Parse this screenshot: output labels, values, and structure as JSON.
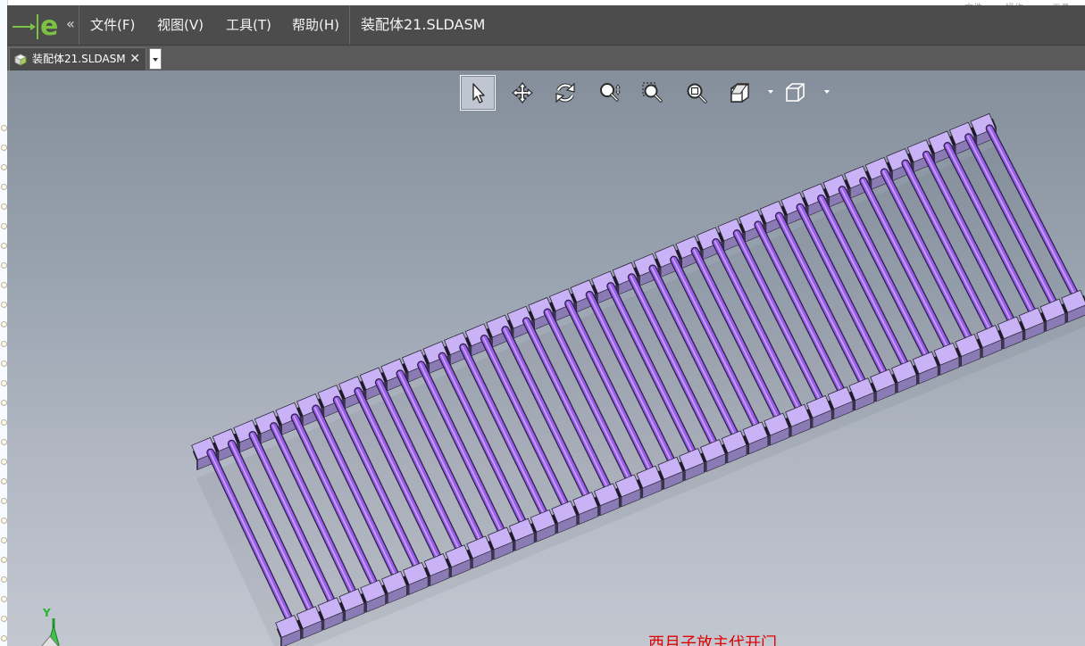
{
  "app": {
    "logo_icon": "edrawings-logo-icon",
    "brand_color": "#7cc242",
    "collapse_label": "«"
  },
  "menu": {
    "items": [
      {
        "label": "文件(F)"
      },
      {
        "label": "视图(V)"
      },
      {
        "label": "工具(T)"
      },
      {
        "label": "帮助(H)"
      }
    ],
    "document_title": "装配体21.SLDASM"
  },
  "tabs": [
    {
      "label": "装配体21.SLDASM",
      "close_label": "✕",
      "icon": "assembly-icon"
    }
  ],
  "toolbar": {
    "tools": [
      {
        "name": "select-tool",
        "icon": "pointer-icon",
        "active": true
      },
      {
        "name": "pan-tool",
        "icon": "move-icon",
        "active": false
      },
      {
        "name": "rotate-tool",
        "icon": "rotate-icon",
        "active": false
      },
      {
        "name": "zoom-tool",
        "icon": "zoom-icon",
        "active": false
      },
      {
        "name": "zoom-area-tool",
        "icon": "zoom-area-icon",
        "active": false
      },
      {
        "name": "zoom-fit-tool",
        "icon": "zoom-fit-icon",
        "active": false
      },
      {
        "name": "section-view-tool",
        "icon": "section-icon",
        "active": false
      },
      {
        "name": "display-style-tool",
        "icon": "cube-icon",
        "active": false
      }
    ]
  },
  "viewport": {
    "part_color": "#c9b2f5",
    "rod_color": "#9a5fe8",
    "rod_count": 38,
    "triad_axis_label": "Y",
    "status_message": "西月子放主代开门"
  },
  "background_text": [
    "文件",
    "操作",
    "工具"
  ]
}
